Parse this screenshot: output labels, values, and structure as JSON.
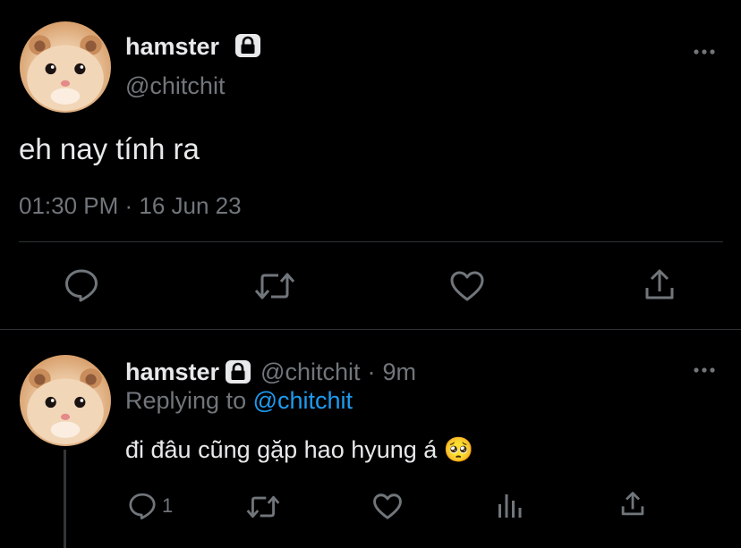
{
  "main_tweet": {
    "display_name": "hamster",
    "handle": "@chitchit",
    "text": "eh nay tính ra",
    "timestamp": "01:30 PM · 16 Jun 23",
    "icons": [
      "lock-icon",
      "more-icon",
      "reply-icon",
      "retweet-icon",
      "like-icon",
      "share-icon"
    ]
  },
  "reply_tweet": {
    "display_name": "hamster",
    "handle": "@chitchit",
    "separator": "·",
    "age": "9m",
    "replying_prefix": "Replying to",
    "replying_handle": "@chitchit",
    "text": "đi đâu cũng gặp hao hyung á",
    "emoji": "🥺",
    "reply_count": "1",
    "icons": [
      "lock-icon",
      "more-icon",
      "reply-icon",
      "retweet-icon",
      "like-icon",
      "views-icon",
      "share-icon"
    ]
  },
  "colors": {
    "background": "#000000",
    "text": "#e7e9ea",
    "muted": "#71767b",
    "link": "#1d9bf0",
    "divider": "#2f3336"
  }
}
